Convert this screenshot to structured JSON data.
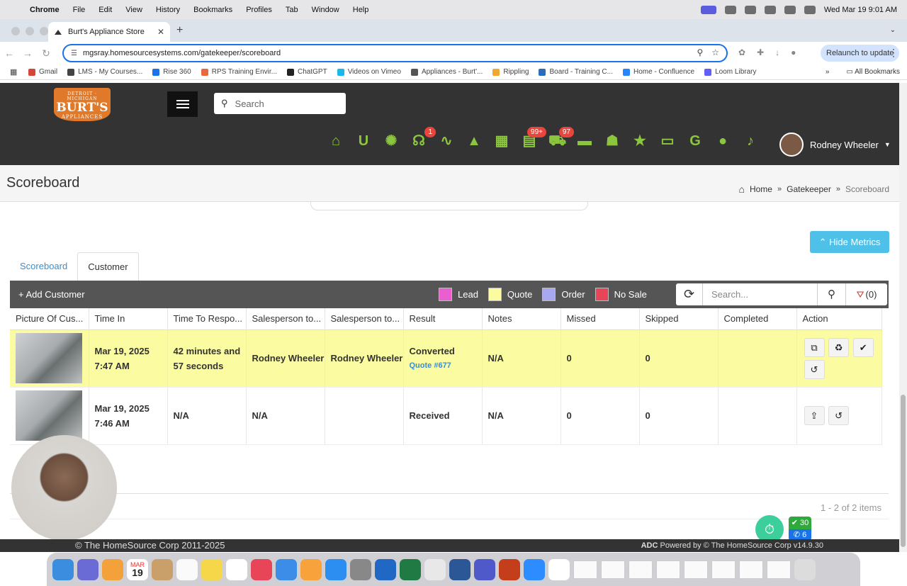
{
  "menubar": {
    "apple": "",
    "items": [
      "Chrome",
      "File",
      "Edit",
      "View",
      "History",
      "Bookmarks",
      "Profiles",
      "Tab",
      "Window",
      "Help"
    ],
    "datetime": "Wed Mar 19  9:01 AM"
  },
  "browser": {
    "tab_title": "Burt's Appliance Store",
    "url": "mgsray.homesourcesystems.com/gatekeeper/scoreboard",
    "relaunch_label": "Relaunch to update",
    "bookmarks": [
      "Gmail",
      "LMS - My Courses...",
      "Rise 360",
      "RPS Training Envir...",
      "ChatGPT",
      "Videos on Vimeo",
      "Appliances - Burt'...",
      "Rippling",
      "Board - Training C...",
      "Home - Confluence",
      "Loom Library"
    ],
    "all_bookmarks": "All Bookmarks",
    "bookmark_colors": [
      "#d44638",
      "#444",
      "#1a73e8",
      "#e8693c",
      "#222",
      "#1ab7ea",
      "#555",
      "#f0a830",
      "#2a6ebb",
      "#2684ff",
      "#625df5"
    ]
  },
  "app": {
    "logo": {
      "top": "DETROIT · MICHIGAN",
      "name": "BURT'S",
      "sub": "APPLIANCES"
    },
    "search_placeholder": "Search",
    "nav_icons": [
      {
        "icon": "home-icon",
        "glyph": "⌂",
        "badge": ""
      },
      {
        "icon": "magnet-icon",
        "glyph": "U",
        "badge": ""
      },
      {
        "icon": "gear-icon",
        "glyph": "✺",
        "badge": ""
      },
      {
        "icon": "stethoscope-icon",
        "glyph": "☊",
        "badge": "1"
      },
      {
        "icon": "line-chart-icon",
        "glyph": "∿",
        "badge": ""
      },
      {
        "icon": "graduation-cap-icon",
        "glyph": "▲",
        "badge": ""
      },
      {
        "icon": "calculator-icon",
        "glyph": "▦",
        "badge": ""
      },
      {
        "icon": "clipboard-icon",
        "glyph": "▤",
        "badge": "99+"
      },
      {
        "icon": "cart-icon",
        "glyph": "⛟",
        "badge": "97"
      },
      {
        "icon": "briefcase-icon",
        "glyph": "▬",
        "badge": ""
      },
      {
        "icon": "users-icon",
        "glyph": "☗",
        "badge": ""
      },
      {
        "icon": "star-icon",
        "glyph": "★",
        "badge": ""
      },
      {
        "icon": "folder-icon",
        "glyph": "▭",
        "badge": ""
      },
      {
        "icon": "google-icon",
        "glyph": "G",
        "badge": ""
      },
      {
        "icon": "chat-icon",
        "glyph": "●",
        "badge": ""
      },
      {
        "icon": "bell-icon",
        "glyph": "♪",
        "badge": ""
      }
    ],
    "user_name": "Rodney Wheeler",
    "accent": "#8cc63f"
  },
  "page": {
    "title": "Scoreboard",
    "breadcrumb": {
      "home": "Home",
      "mid": "Gatekeeper",
      "current": "Scoreboard"
    },
    "hide_metrics": "Hide Metrics",
    "tabs": [
      "Scoreboard",
      "Customer"
    ]
  },
  "grid": {
    "add_customer": "Add Customer",
    "legend": [
      {
        "label": "Lead",
        "color": "#e95fd0"
      },
      {
        "label": "Quote",
        "color": "#fbfba2"
      },
      {
        "label": "Order",
        "color": "#a8a8f0"
      },
      {
        "label": "No Sale",
        "color": "#e8455a"
      }
    ],
    "search_placeholder": "Search...",
    "filter_count": "(0)",
    "columns": [
      "Picture Of Cus...",
      "Time In",
      "Time To Respo...",
      "Salesperson to...",
      "Salesperson to...",
      "Result",
      "Notes",
      "Missed",
      "Skipped",
      "Completed",
      "Action"
    ],
    "rows": [
      {
        "time_in": "Mar 19, 2025 7:47 AM",
        "time_to_respond": "42 minutes and 57 seconds",
        "salesperson1": "Rodney Wheeler",
        "salesperson2": "Rodney Wheeler",
        "result": "Converted",
        "quote_link": "Quote #677",
        "notes": "N/A",
        "missed": "0",
        "skipped": "0",
        "completed": ""
      },
      {
        "time_in": "Mar 19, 2025 7:46 AM",
        "time_to_respond": "N/A",
        "salesperson1": "N/A",
        "salesperson2": "",
        "result": "Received",
        "quote_link": "",
        "notes": "N/A",
        "missed": "0",
        "skipped": "0",
        "completed": ""
      }
    ],
    "item_count": "1 - 2 of 2 items"
  },
  "widgets": {
    "chat_count_a": "30",
    "chat_count_b": "6"
  },
  "footer": {
    "copyright": "© The HomeSource Corp 2011-2025",
    "adc": "ADC",
    "powered": "Powered by © The HomeSource Corp",
    "version": "v14.9.30"
  },
  "dock": {
    "cal_month": "MAR",
    "cal_day": "19"
  }
}
